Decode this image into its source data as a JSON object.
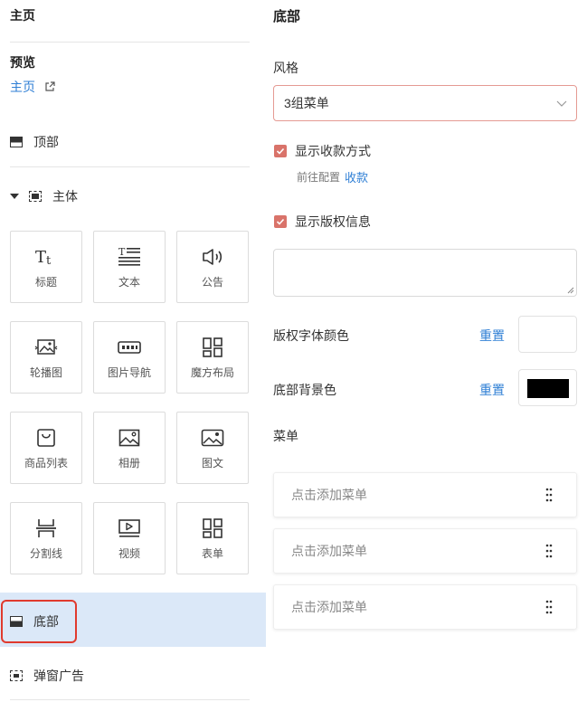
{
  "left": {
    "home_title": "主页",
    "preview_label": "预览",
    "preview_link": "主页",
    "sections": {
      "top": "顶部",
      "body": "主体",
      "bottom": "底部",
      "popup": "弹窗广告"
    },
    "components": [
      {
        "label": "标题",
        "icon": "title-icon"
      },
      {
        "label": "文本",
        "icon": "text-icon"
      },
      {
        "label": "公告",
        "icon": "speaker-icon"
      },
      {
        "label": "轮播图",
        "icon": "carousel-icon"
      },
      {
        "label": "图片导航",
        "icon": "image-nav-icon"
      },
      {
        "label": "魔方布局",
        "icon": "cube-layout-icon"
      },
      {
        "label": "商品列表",
        "icon": "shopping-bag-icon"
      },
      {
        "label": "相册",
        "icon": "album-icon"
      },
      {
        "label": "图文",
        "icon": "image-text-icon"
      },
      {
        "label": "分割线",
        "icon": "divider-icon"
      },
      {
        "label": "视频",
        "icon": "video-icon"
      },
      {
        "label": "表单",
        "icon": "form-icon"
      }
    ]
  },
  "right": {
    "title": "底部",
    "style_label": "风格",
    "style_value": "3组菜单",
    "show_payment_label": "显示收款方式",
    "payment_sub_prefix": "前往配置",
    "payment_sub_link": "收款",
    "show_copyright_label": "显示版权信息",
    "copyright_text": "",
    "copyright_font_color_label": "版权字体颜色",
    "bottom_bg_color_label": "底部背景色",
    "reset_label": "重置",
    "copyright_font_color": "#ffffff",
    "bottom_bg_color": "#000000",
    "menu_label": "菜单",
    "menu_items": [
      "点击添加菜单",
      "点击添加菜单",
      "点击添加菜单"
    ]
  },
  "colors": {
    "accent_blue": "#2f7fd5",
    "checkbox": "#d9736a",
    "active_bg": "#dbe8f8",
    "highlight": "#e03a2e"
  }
}
